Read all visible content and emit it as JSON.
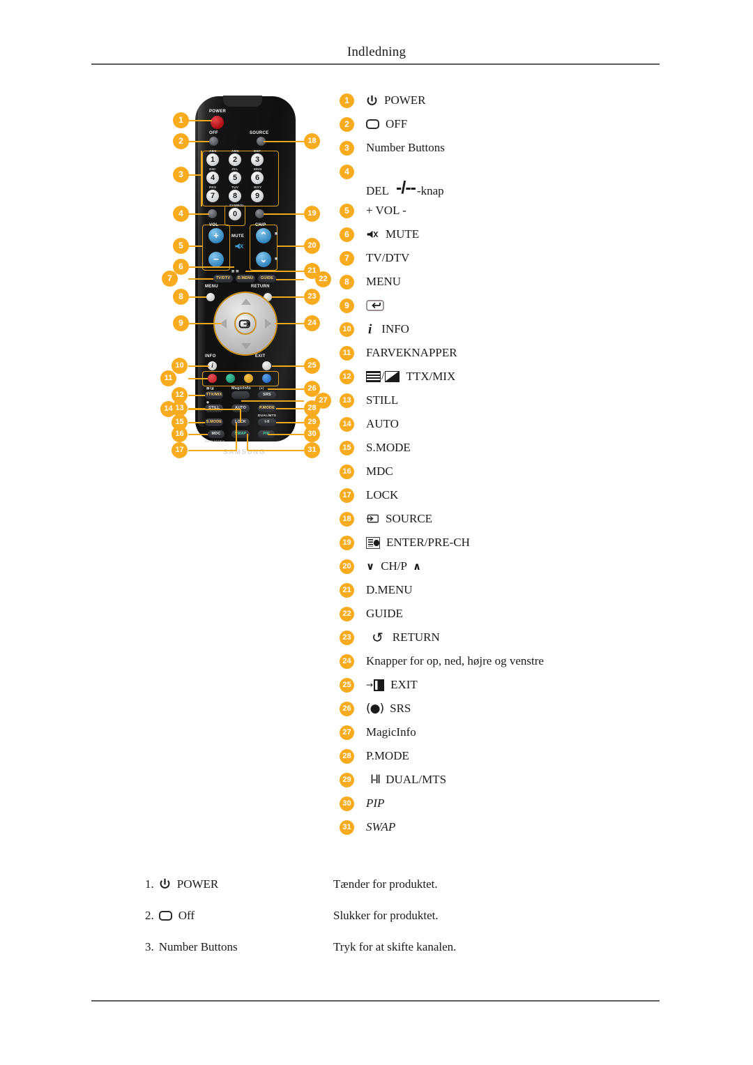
{
  "header": {
    "title": "Indledning"
  },
  "colors": {
    "badge": "#f9ab1e",
    "accent_outline": "#e0a21e",
    "rule": "#5c5c5c"
  },
  "legend": {
    "items": [
      {
        "num": "1",
        "icon": "power-icon",
        "label": "POWER"
      },
      {
        "num": "2",
        "icon": "off-rect-icon",
        "label": "OFF"
      },
      {
        "num": "3",
        "icon": "",
        "label": "Number Buttons"
      },
      {
        "num": "4",
        "icon": "del-dash-icon",
        "label": "DEL",
        "label_after": "-knap"
      },
      {
        "num": "5",
        "icon": "",
        "label": "+ VOL -"
      },
      {
        "num": "6",
        "icon": "mute-icon",
        "label": "MUTE"
      },
      {
        "num": "7",
        "icon": "",
        "label": "TV/DTV"
      },
      {
        "num": "8",
        "icon": "",
        "label": "MENU"
      },
      {
        "num": "9",
        "icon": "enter-box-icon",
        "label": ""
      },
      {
        "num": "10",
        "icon": "info-i-icon",
        "label": "INFO"
      },
      {
        "num": "11",
        "icon": "",
        "label": "FARVEKNAPPER"
      },
      {
        "num": "12",
        "icon": "ttx-mix-icon",
        "label": "TTX/MIX"
      },
      {
        "num": "13",
        "icon": "",
        "label": "STILL"
      },
      {
        "num": "14",
        "icon": "",
        "label": "AUTO"
      },
      {
        "num": "15",
        "icon": "",
        "label": "S.MODE"
      },
      {
        "num": "16",
        "icon": "",
        "label": "MDC"
      },
      {
        "num": "17",
        "icon": "",
        "label": "LOCK"
      },
      {
        "num": "18",
        "icon": "source-icon",
        "label": "SOURCE"
      },
      {
        "num": "19",
        "icon": "pre-ch-icon",
        "label": "ENTER/PRE-CH"
      },
      {
        "num": "20",
        "icon": "ch-arrows-icon",
        "label": "CH/P"
      },
      {
        "num": "21",
        "icon": "",
        "label": "D.MENU"
      },
      {
        "num": "22",
        "icon": "",
        "label": "GUIDE"
      },
      {
        "num": "23",
        "icon": "return-arrow-icon",
        "label": "RETURN"
      },
      {
        "num": "24",
        "icon": "",
        "label": "Knapper for op, ned, højre og venstre"
      },
      {
        "num": "25",
        "icon": "exit-door-icon",
        "label": "EXIT"
      },
      {
        "num": "26",
        "icon": "srs-icon",
        "label": "SRS"
      },
      {
        "num": "27",
        "icon": "",
        "label": "MagicInfo"
      },
      {
        "num": "28",
        "icon": "",
        "label": "P.MODE"
      },
      {
        "num": "29",
        "icon": "dual-mts-icon",
        "label": "DUAL/MTS"
      },
      {
        "num": "30",
        "icon": "",
        "label": "PIP",
        "italic": true
      },
      {
        "num": "31",
        "icon": "",
        "label": "SWAP",
        "italic": true
      }
    ]
  },
  "remote": {
    "brand": "SAMSUNG",
    "labels": {
      "power": "POWER",
      "off": "OFF",
      "source": "SOURCE",
      "vol": "VOL",
      "mute": "MUTE",
      "chp": "CH/P",
      "tvdtv": "TV/DTV",
      "dmenu": "D.MENU",
      "guide": "GUIDE",
      "menu": "MENU",
      "return": "RETURN",
      "info": "INFO",
      "exit": "EXIT",
      "ttxmix": "TTX/MIX",
      "magicinfo": "MagicInfo",
      "srs": "SRS",
      "still": "STILL",
      "auto": "AUTO",
      "pmode": "P.MODE",
      "smode": "S.MODE",
      "lock": "LOCK",
      "dualmts": "DUAL/MTS",
      "dualglyph": "I-II",
      "mdc": "MDC",
      "swap": "SWAP",
      "pip": "PIP",
      "rm": "BN59-00752A"
    },
    "keypad": [
      {
        "key": "1",
        "sub": "ABC"
      },
      {
        "key": "2",
        "sub": "ABC"
      },
      {
        "key": "3",
        "sub": "DEF"
      },
      {
        "key": "4",
        "sub": "GHI"
      },
      {
        "key": "5",
        "sub": "JKL"
      },
      {
        "key": "6",
        "sub": "MNO"
      },
      {
        "key": "7",
        "sub": "PRS"
      },
      {
        "key": "8",
        "sub": "TUV"
      },
      {
        "key": "9",
        "sub": "WXY"
      },
      {
        "key": "0",
        "sub": "SYMBOL"
      }
    ],
    "callouts_left": [
      "1",
      "2",
      "3",
      "4",
      "5",
      "6",
      "7",
      "8",
      "9",
      "10",
      "11",
      "12",
      "13",
      "14",
      "15",
      "16",
      "17"
    ],
    "callouts_right": [
      "18",
      "19",
      "20",
      "21",
      "22",
      "23",
      "24",
      "25",
      "26",
      "27",
      "28",
      "29",
      "30",
      "31"
    ]
  },
  "bottom": {
    "rows": [
      {
        "num": "1.",
        "icon": "power-icon",
        "label": "POWER",
        "desc": "Tænder for produktet."
      },
      {
        "num": "2.",
        "icon": "off-rect-icon",
        "label": "Off",
        "desc": "Slukker for produktet."
      },
      {
        "num": "3.",
        "icon": "",
        "label": "Number Buttons",
        "desc": "Tryk for at skifte kanalen."
      }
    ]
  }
}
